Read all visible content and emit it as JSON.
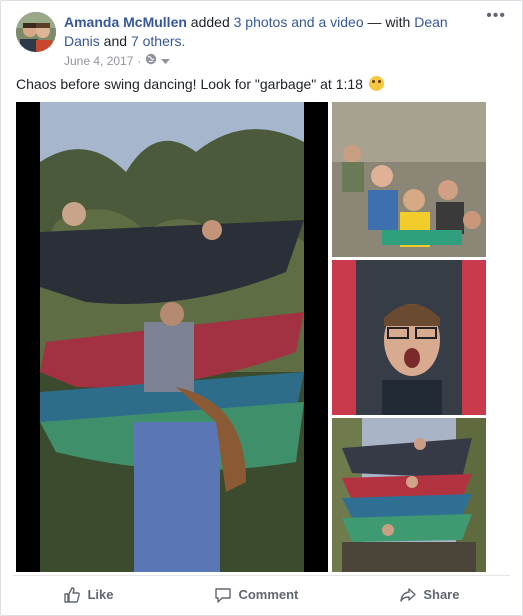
{
  "post": {
    "author": "Amanda McMullen",
    "action_prefix": " added ",
    "action_link": "3 photos and a video",
    "with_text": " — with ",
    "tagged_person": "Dean Danis",
    "and_text": " and ",
    "others_link": "7 others.",
    "date": "June 4, 2017",
    "date_separator": " · ",
    "more_label": "•••",
    "caption_text": "Chaos before swing dancing! Look for \"garbage\" at 1:18",
    "icons": {
      "globe": "globe-icon",
      "privacy_dropdown": "chevron-down-icon",
      "emoji": "rolling-laughing-emoji"
    }
  },
  "media": {
    "video": "video-thumbnail",
    "photos": [
      "group-selfie-photo",
      "hammock-selfie-photo",
      "hammock-tower-photo"
    ]
  },
  "actions": {
    "like": "Like",
    "comment": "Comment",
    "share": "Share"
  },
  "colors": {
    "link": "#365899",
    "meta": "#90949c",
    "action": "#606770"
  }
}
